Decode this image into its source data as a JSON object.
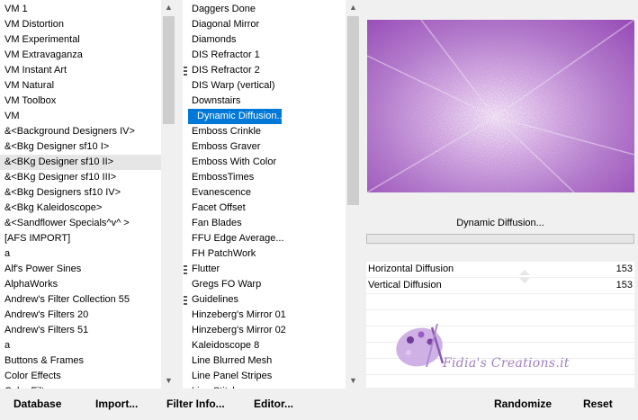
{
  "categories": {
    "items": [
      "VM 1",
      "VM Distortion",
      "VM Experimental",
      "VM Extravaganza",
      "VM Instant Art",
      "VM Natural",
      "VM Toolbox",
      "VM",
      "&<Background Designers IV>",
      "&<Bkg Designer sf10 I>",
      "&<BKg Designer sf10 II>",
      "&<BKg Designer sf10 III>",
      "&<Bkg Designers sf10 IV>",
      "&<Bkg Kaleidoscope>",
      "&<Sandflower Specials^v^ >",
      "[AFS IMPORT]",
      "a",
      "Alf's Power Sines",
      "AlphaWorks",
      "Andrew's Filter Collection 55",
      "Andrew's Filters 20",
      "Andrew's Filters 51",
      "a",
      "Buttons & Frames",
      "Color Effects",
      "Color Filter"
    ],
    "selected_index": 10
  },
  "filters": {
    "items": [
      {
        "label": "Daggers Done",
        "marked": false
      },
      {
        "label": "Diagonal Mirror",
        "marked": false
      },
      {
        "label": "Diamonds",
        "marked": false
      },
      {
        "label": "DIS Refractor 1",
        "marked": false
      },
      {
        "label": "DIS Refractor 2",
        "marked": true
      },
      {
        "label": "DIS Warp (vertical)",
        "marked": false
      },
      {
        "label": "Downstairs",
        "marked": false
      },
      {
        "label": "Dynamic Diffusion...",
        "marked": false
      },
      {
        "label": "Emboss Crinkle",
        "marked": false
      },
      {
        "label": "Emboss Graver",
        "marked": false
      },
      {
        "label": "Emboss With Color",
        "marked": false
      },
      {
        "label": "EmbossTimes",
        "marked": false
      },
      {
        "label": "Evanescence",
        "marked": false
      },
      {
        "label": "Facet Offset",
        "marked": false
      },
      {
        "label": "Fan Blades",
        "marked": false
      },
      {
        "label": "FFU Edge Average...",
        "marked": false
      },
      {
        "label": "FH PatchWork",
        "marked": false
      },
      {
        "label": "Flutter",
        "marked": true
      },
      {
        "label": "Gregs FO Warp",
        "marked": false
      },
      {
        "label": "Guidelines",
        "marked": true
      },
      {
        "label": "Hinzeberg's Mirror 01",
        "marked": false
      },
      {
        "label": "Hinzeberg's Mirror 02",
        "marked": false
      },
      {
        "label": "Kaleidoscope 8",
        "marked": false
      },
      {
        "label": "Line Blurred Mesh",
        "marked": false
      },
      {
        "label": "Line Panel Stripes",
        "marked": false
      },
      {
        "label": "Line Stitches",
        "marked": false
      }
    ],
    "selected_index": 7
  },
  "preview": {
    "filter_button_label": "Dynamic Diffusion...",
    "colors": {
      "light": "#ffffff",
      "mid": "#c69bda",
      "dark": "#8a3aae"
    }
  },
  "params": [
    {
      "label": "Horizontal Diffusion",
      "value": "153"
    },
    {
      "label": "Vertical Diffusion",
      "value": "153"
    }
  ],
  "watermark": {
    "text": "Fidia's Creations.it"
  },
  "bottom_buttons": {
    "database": "Database",
    "import": "Import...",
    "filter_info": "Filter Info...",
    "editor": "Editor...",
    "randomize": "Randomize",
    "reset": "Reset"
  },
  "icons": {
    "scroll_up": "▲",
    "scroll_down": "▼"
  }
}
